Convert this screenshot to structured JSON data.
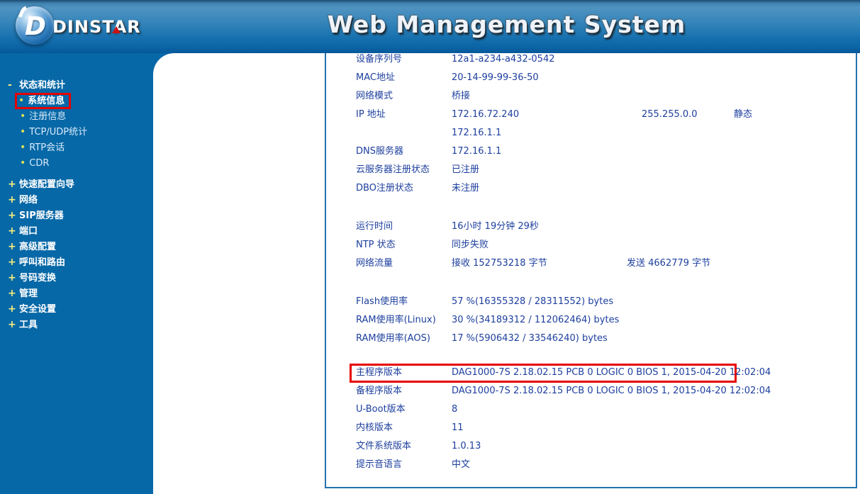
{
  "colors": {
    "accent_red": "#e60000",
    "sidebar_bg": "#0768a7",
    "text_navy": "#1d3f9e",
    "box_border": "#2373ae",
    "marker_yellow": "#f7ee7d"
  },
  "header": {
    "title": "Web Management System",
    "brand": {
      "name": "DINSTAR",
      "logo_letter": "D"
    }
  },
  "sidebar": {
    "groups": [
      {
        "marker": "-",
        "label": "状态和统计",
        "expanded": true,
        "items": [
          {
            "label": "系统信息",
            "selected": true,
            "highlighted": true
          },
          {
            "label": "注册信息"
          },
          {
            "label": "TCP/UDP统计"
          },
          {
            "label": "RTP会话"
          },
          {
            "label": "CDR"
          }
        ]
      },
      {
        "marker": "+",
        "label": "快速配置向导"
      },
      {
        "marker": "+",
        "label": "网络"
      },
      {
        "marker": "+",
        "label": "SIP服务器"
      },
      {
        "marker": "+",
        "label": "端口"
      },
      {
        "marker": "+",
        "label": "高级配置"
      },
      {
        "marker": "+",
        "label": "呼叫和路由"
      },
      {
        "marker": "+",
        "label": "号码变换"
      },
      {
        "marker": "+",
        "label": "管理"
      },
      {
        "marker": "+",
        "label": "安全设置"
      },
      {
        "marker": "+",
        "label": "工具"
      }
    ]
  },
  "system_info": {
    "sections": [
      {
        "rows": [
          {
            "label": "设备序列号",
            "value": "12a1-a234-a432-0542"
          },
          {
            "label": "MAC地址",
            "value": "20-14-99-99-36-50"
          },
          {
            "label": "网络模式",
            "value": "桥接"
          },
          {
            "label": "IP 地址",
            "value": "172.16.72.240",
            "value2": "255.255.0.0",
            "value3": "静态"
          },
          {
            "label": "",
            "value": "172.16.1.1"
          },
          {
            "label": "DNS服务器",
            "value": "172.16.1.1"
          },
          {
            "label": "云服务器注册状态",
            "value": "已注册"
          },
          {
            "label": "DBO注册状态",
            "value": "未注册"
          }
        ]
      },
      {
        "rows": [
          {
            "label": "运行时间",
            "value": "16小时 19分钟 29秒"
          },
          {
            "label": "NTP 状态",
            "value": "同步失败"
          },
          {
            "label": "网络流量",
            "value": "接收  152753218 字节",
            "value2": "发送  4662779 字节"
          }
        ]
      },
      {
        "rows": [
          {
            "label": "Flash使用率",
            "value": "57 %(16355328 / 28311552) bytes"
          },
          {
            "label": "RAM使用率(Linux)",
            "value": "30 %(34189312 / 112062464) bytes"
          },
          {
            "label": "RAM使用率(AOS)",
            "value": "17 %(5906432 / 33546240) bytes"
          }
        ]
      },
      {
        "rows": [
          {
            "label": "主程序版本",
            "value": "DAG1000-7S 2.18.02.15 PCB 0 LOGIC 0 BIOS 1, 2015-04-20 12:02:04",
            "highlighted": true
          },
          {
            "label": "备程序版本",
            "value": "DAG1000-7S 2.18.02.15 PCB 0 LOGIC 0 BIOS 1, 2015-04-20 12:02:04"
          },
          {
            "label": "U-Boot版本",
            "value": "8"
          },
          {
            "label": "内核版本",
            "value": "11"
          },
          {
            "label": "文件系统版本",
            "value": "1.0.13"
          },
          {
            "label": "提示音语言",
            "value": "中文"
          }
        ]
      }
    ]
  }
}
